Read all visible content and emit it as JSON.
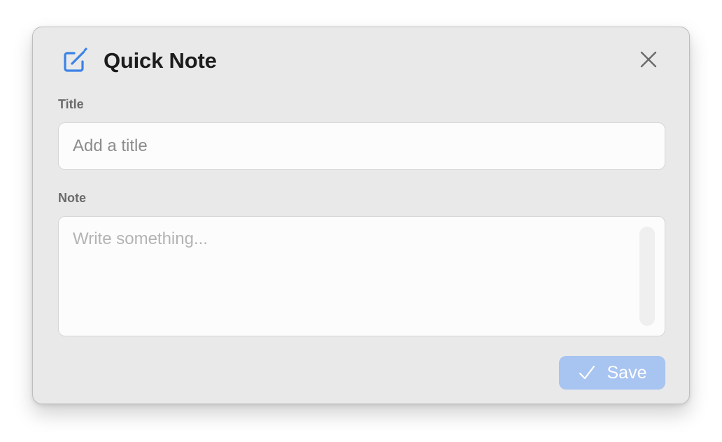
{
  "dialog": {
    "title": "Quick Note",
    "header_icon": "compose-icon",
    "close_icon": "close-icon",
    "accent_color": "#3b82e6"
  },
  "fields": {
    "title": {
      "label": "Title",
      "placeholder": "Add a title",
      "value": ""
    },
    "note": {
      "label": "Note",
      "placeholder": "Write something...",
      "value": ""
    }
  },
  "actions": {
    "save_label": "Save",
    "save_icon": "checkmark-icon",
    "save_disabled": true,
    "save_color": "#a8c4f0"
  }
}
